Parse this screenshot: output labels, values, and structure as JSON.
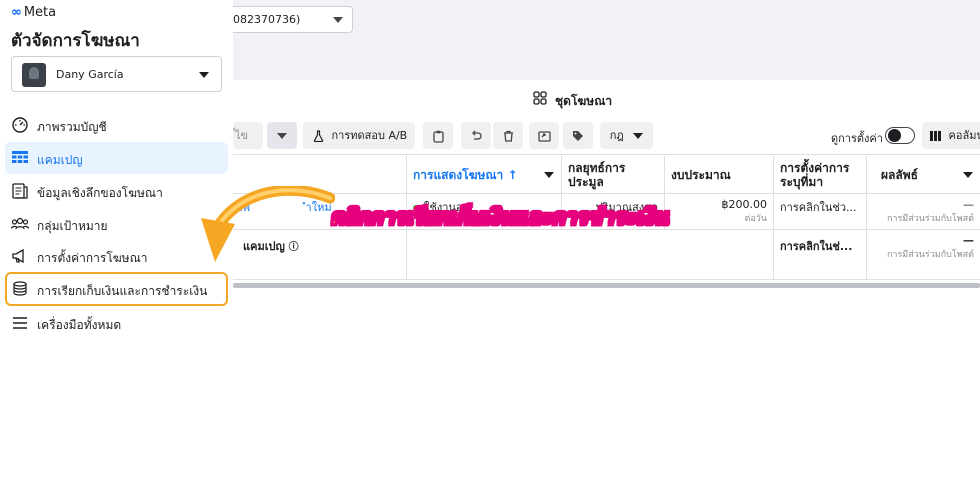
{
  "header": {
    "account_selector_value": "082370736)"
  },
  "sidebar": {
    "brand": "Meta",
    "title": "ตัวจัดการโฆษณา",
    "user_name": "Dany García",
    "items": [
      {
        "label": "ภาพรวมบัญชี",
        "icon": "gauge-icon"
      },
      {
        "label": "แคมเปญ",
        "icon": "grid-table-icon"
      },
      {
        "label": "ข้อมูลเชิงลึกของโฆษณา",
        "icon": "insights-icon"
      },
      {
        "label": "กลุ่มเป้าหมาย",
        "icon": "people-icon"
      },
      {
        "label": "การตั้งค่าการโฆษณา",
        "icon": "megaphone-icon"
      },
      {
        "label": "การเรียกเก็บเงินและการชำระเงิน",
        "icon": "coins-icon"
      },
      {
        "label": "เครื่องมือทั้งหมด",
        "icon": "menu-icon"
      }
    ]
  },
  "tabs": {
    "right_label": "ชุดโฆษณา"
  },
  "toolbar": {
    "edit_label": "้ไข",
    "ab_test_label": "การทดสอบ A/B",
    "rules_label": "กฎ",
    "view_settings_label": "ดูการตั้งค่า",
    "columns_label": "คอลัมน"
  },
  "table": {
    "headers": {
      "delivery": "การแสดงโฆษณา ↑",
      "bid_strategy": "กลยุทธ์การประมูล",
      "budget": "งบประมาณ",
      "attribution": "การตั้งค่าการระบุที่มา",
      "results": "ผลลัพธ์"
    },
    "row1": {
      "name_fragment": "เพ",
      "name_fragment2": "ำใหม่",
      "delivery": "ใช้งานอยู่",
      "bid_strategy": "ปริมาณสูงสุด",
      "budget": "฿200.00",
      "budget_period": "ต่อวัน",
      "attribution": "การคลิกในช่ว...",
      "results": "—",
      "results_sub": "การมีส่วนร่วมกับโพสต์"
    },
    "row2": {
      "name": "แคมเปญ",
      "attribution": "การคลิกในช่...",
      "results": "—",
      "results_sub": "การมีส่วนร่วมกับโพสต์"
    }
  },
  "annotation": {
    "callout_text": "คลิกการเรียกเก็บเงินและการชำระเงิน",
    "highlight_color": "#f5a623"
  },
  "colors": {
    "accent": "#1877f2",
    "active_bg": "#e7f3ff",
    "status_active": "#44b700"
  }
}
